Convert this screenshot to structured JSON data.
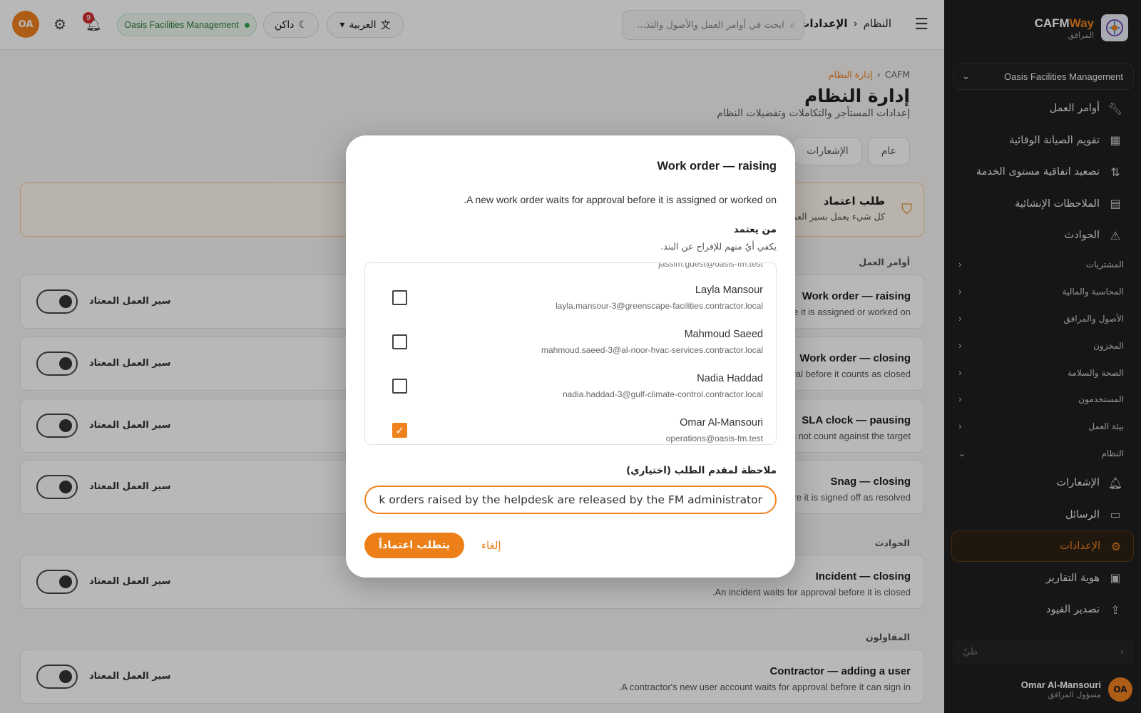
{
  "sidebar": {
    "brand_name_a": "CAFM",
    "brand_name_b": "Way",
    "brand_sub": "المرافق",
    "tenant": "Oasis Facilities Management",
    "items": [
      {
        "label": "أوامر العمل",
        "icon": "wrench-icon"
      },
      {
        "label": "تقويم الصيانة الوقائية",
        "icon": "calendar-icon"
      },
      {
        "label": "تصعيد اتفاقية مستوى الخدمة",
        "icon": "escalation-icon"
      },
      {
        "label": "الملاحظات الإنشائية",
        "icon": "clipboard-icon"
      },
      {
        "label": "الحوادث",
        "icon": "warning-icon"
      }
    ],
    "groups": [
      "المشتريات",
      "المحاسبة والمالية",
      "الأصول والمرافق",
      "المخزون",
      "الصحة والسلامة",
      "المستخدمون",
      "بيئة العمل",
      "النظام"
    ],
    "system_items": [
      {
        "label": "الإشعارات",
        "icon": "bell-icon"
      },
      {
        "label": "الرسائل",
        "icon": "chat-icon"
      },
      {
        "label": "الإعدادات",
        "icon": "gear-icon",
        "active": true
      },
      {
        "label": "هوية التقارير",
        "icon": "report-icon"
      },
      {
        "label": "تصدير القيود",
        "icon": "export-icon"
      }
    ],
    "collapse_label": "طيّ",
    "user_name": "Omar Al-Mansouri",
    "user_role": "مسؤول المرافق",
    "user_initials": "OA"
  },
  "topbar": {
    "crumb_parent": "النظام",
    "crumb_current": "الإعدادات",
    "search_placeholder": "ابحث في أوامر العمل والأصول والتذ...",
    "language": "العربية",
    "theme": "داكن",
    "tenant_chip": "Oasis Facilities Management",
    "notif_count": "9",
    "initials": "OA"
  },
  "page": {
    "crumb_root": "CAFM",
    "crumb_current": "إدارة النظام",
    "title": "إدارة النظام",
    "subtitle": "إعدادات المستأجر والتكاملات وتفضيلات النظام",
    "tabs": [
      "عام",
      "الإشعارات"
    ],
    "approval_title": "طلب اعتماد",
    "approval_sub": "كل شيء يعمل بسير العمل المعتاد",
    "sections": [
      "أوامر العمل",
      "الحوادث",
      "المقاولون"
    ],
    "toggle_label": "سير العمل المعتاد",
    "cards": [
      {
        "title": "Work order — raising",
        "sub": "before it is assigned or worked on"
      },
      {
        "title": "Work order — closing",
        "sub": "approval before it counts as closed"
      },
      {
        "title": "SLA clock — pausing",
        "sub": "does not count against the target"
      },
      {
        "title": "Snag — closing",
        "sub": "before it is signed off as resolved"
      },
      {
        "title": "Incident — closing",
        "sub": "An incident waits for approval before it is closed."
      },
      {
        "title": "Contractor — adding a user",
        "sub": "A contractor's new user account waits for approval before it can sign in."
      }
    ]
  },
  "modal": {
    "title": "Work order — raising",
    "description": "A new work order waits for approval before it is assigned or worked on.",
    "who_label": "من يعتمد",
    "who_hint": "يكفي أيٌ منهم للإفراج عن البند.",
    "cut_off_email": "jassim.guest@oasis-fm.test",
    "approvers": [
      {
        "name": "Layla Mansour",
        "email": "layla.mansour-3@greenscape-facilities.contractor.local",
        "checked": false
      },
      {
        "name": "Mahmoud Saeed",
        "email": "mahmoud.saeed-3@al-noor-hvac-services.contractor.local",
        "checked": false
      },
      {
        "name": "Nadia Haddad",
        "email": "nadia.haddad-3@gulf-climate-control.contractor.local",
        "checked": false
      },
      {
        "name": "Omar Al-Mansouri",
        "email": "operations@oasis-fm.test",
        "checked": true
      }
    ],
    "note_label": "ملاحظة لمقدم الطلب (اختياري)",
    "note_value": "Work orders raised by the helpdesk are released by the FM administrator.",
    "submit_label": "يتطلب اعتماداً",
    "cancel_label": "إلغاء"
  },
  "colors": {
    "accent": "#f0821e",
    "sidebar_bg": "#1f1f1f",
    "success": "#2fa84a"
  }
}
